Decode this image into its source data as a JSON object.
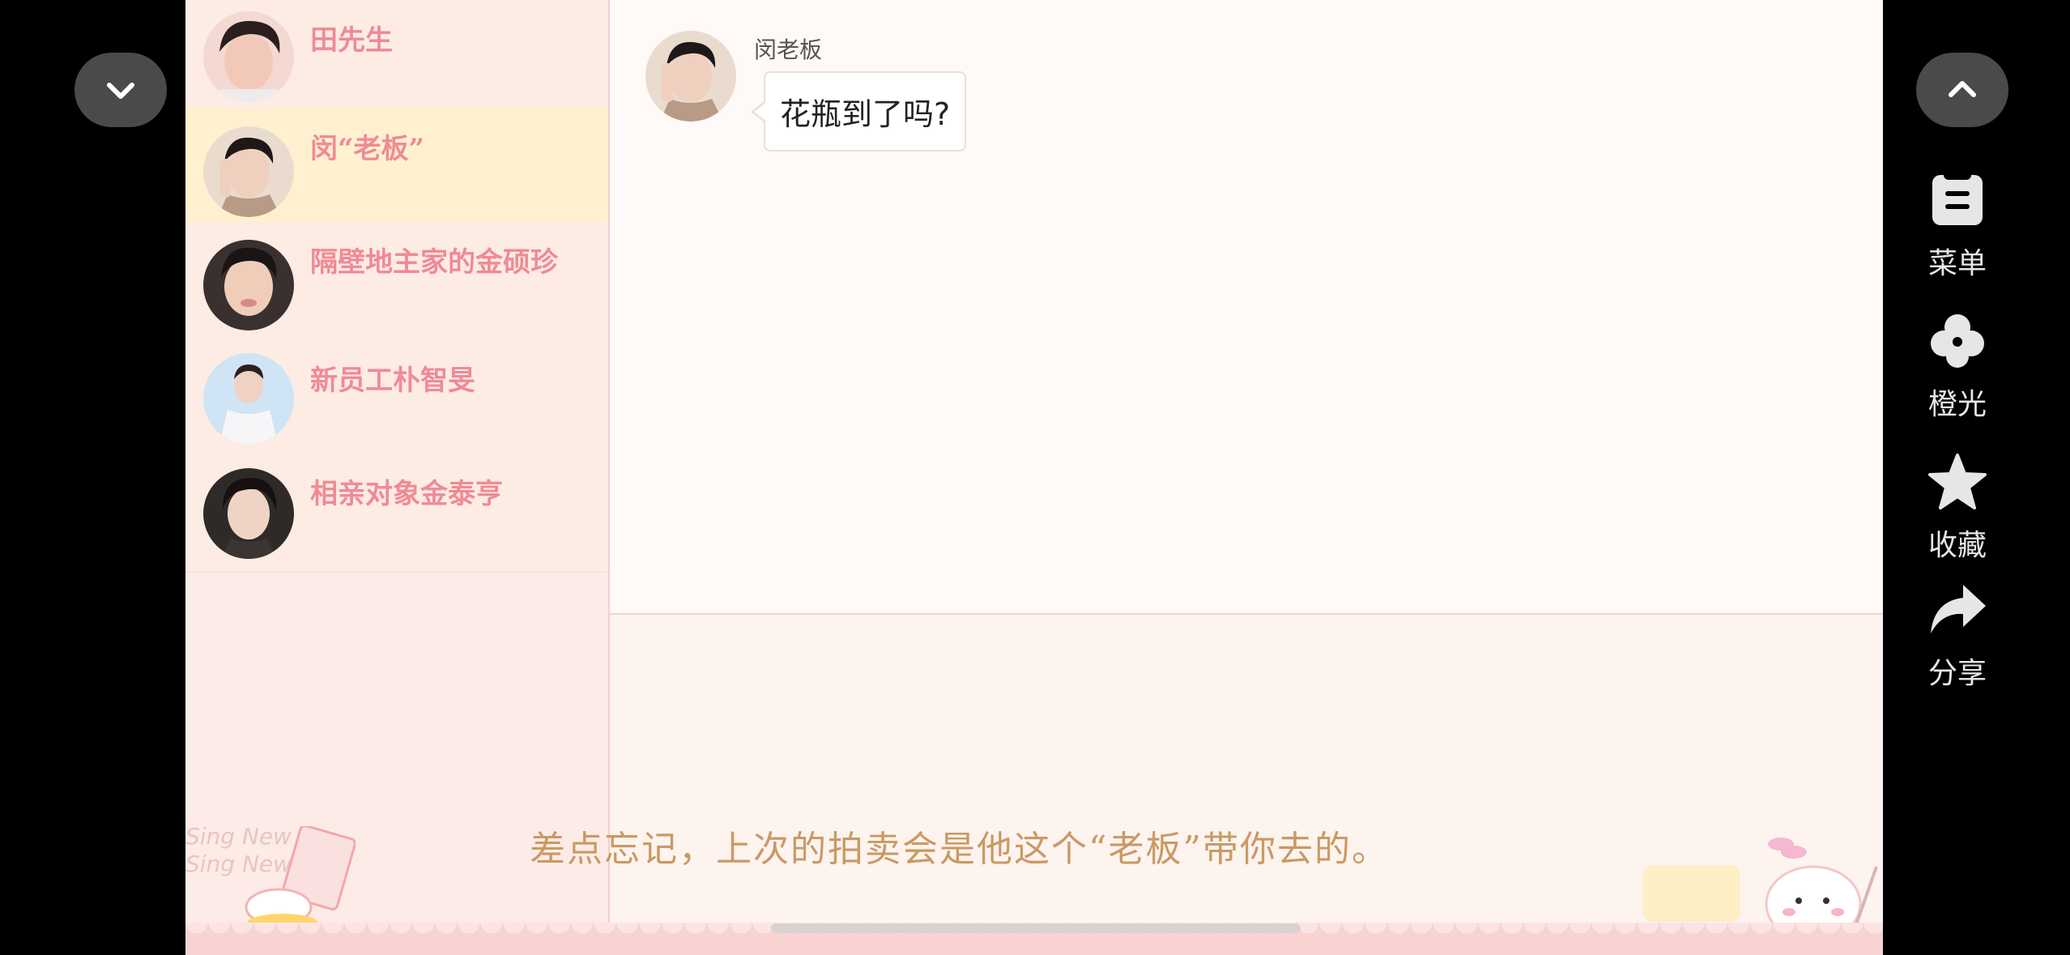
{
  "controls": {
    "collapse_icon": "chevron-down-icon",
    "expand_icon": "chevron-up-icon"
  },
  "contacts": [
    {
      "name": "田先生",
      "active": false
    },
    {
      "name": "闵“老板”",
      "active": true
    },
    {
      "name": "隔壁地主家的金硕珍",
      "active": false
    },
    {
      "name": "新员工朴智旻",
      "active": false
    },
    {
      "name": "相亲对象金泰亨",
      "active": false
    }
  ],
  "chat": {
    "sender": "闵老板",
    "message": "花瓶到了吗?"
  },
  "narration": "差点忘记，上次的拍卖会是他这个“老板”带你去的。",
  "side_menu": [
    {
      "label": "菜单",
      "icon": "menu-icon"
    },
    {
      "label": "橙光",
      "icon": "clover-icon"
    },
    {
      "label": "收藏",
      "icon": "star-icon"
    },
    {
      "label": "分享",
      "icon": "share-icon"
    }
  ],
  "decor": {
    "stamp_text_1": "Sing New",
    "stamp_text_2": "Sing New"
  },
  "colors": {
    "contact_name": "#f08a96",
    "active_row": "#fff1cf",
    "narration": "#c99a63"
  }
}
